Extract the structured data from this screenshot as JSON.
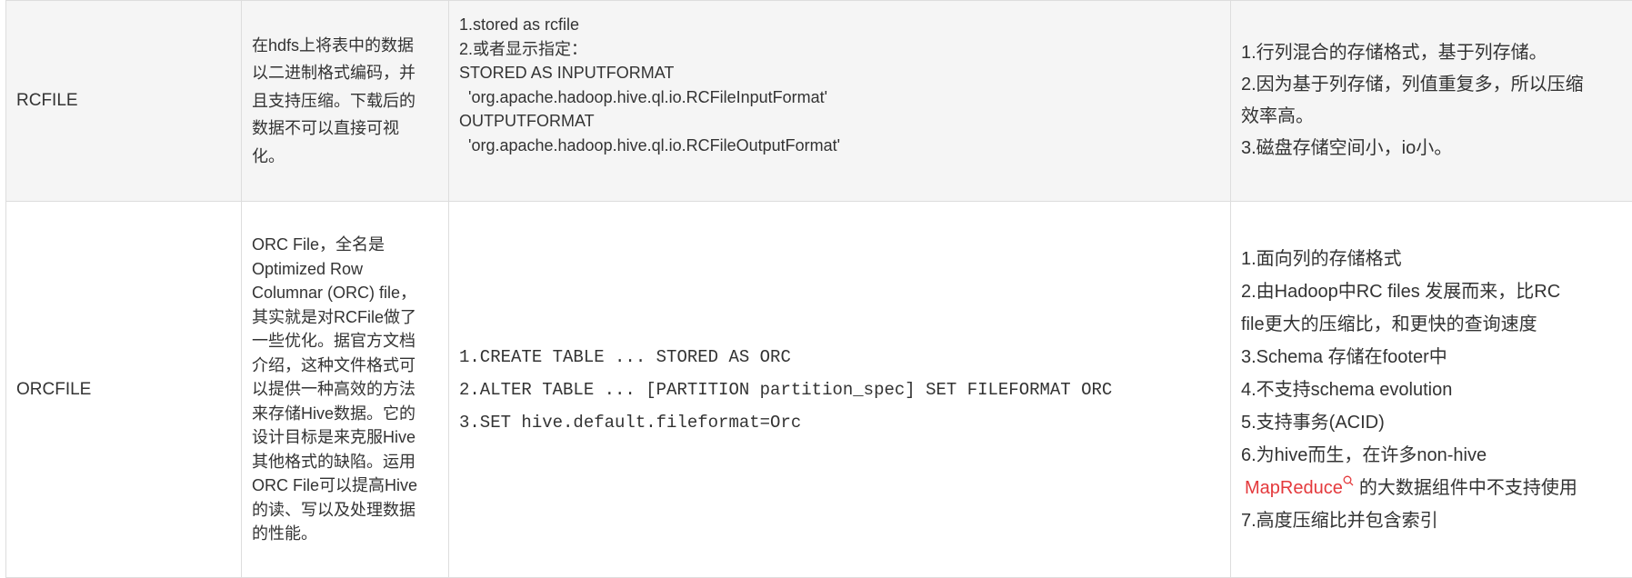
{
  "rows": [
    {
      "name": "RCFILE",
      "desc": [
        "在hdfs上将表中的数据",
        "以二进制格式编码，并",
        "且支持压缩。下载后的",
        "数据不可以直接可视",
        "化。"
      ],
      "usage": [
        "1.stored as rcfile",
        "2.或者显示指定：",
        "STORED AS INPUTFORMAT",
        "  'org.apache.hadoop.hive.ql.io.RCFileInputFormat'",
        "OUTPUTFORMAT",
        "  'org.apache.hadoop.hive.ql.io.RCFileOutputFormat'"
      ],
      "features": [
        "1.行列混合的存储格式，基于列存储。",
        "2.因为基于列存储，列值重复多，所以压缩",
        "效率高。",
        "3.磁盘存储空间小，io小。"
      ]
    },
    {
      "name": "ORCFILE",
      "desc": [
        "ORC File，全名是",
        "Optimized Row",
        "Columnar (ORC) file，",
        "其实就是对RCFile做了",
        "一些优化。据官方文档",
        "介绍，这种文件格式可",
        "以提供一种高效的方法",
        "来存储Hive数据。它的",
        "设计目标是来克服Hive",
        "其他格式的缺陷。运用",
        "ORC File可以提高Hive",
        "的读、写以及处理数据",
        "的性能。"
      ],
      "usage": [
        "1.CREATE TABLE ... STORED AS ORC",
        "2.ALTER TABLE ... [PARTITION partition_spec] SET FILEFORMAT ORC",
        "3.SET hive.default.fileformat=Orc"
      ],
      "features": [
        "1.面向列的存储格式",
        "2.由Hadoop中RC files 发展而来，比RC",
        "file更大的压缩比，和更快的查询速度",
        "3.Schema 存储在footer中",
        "4.不支持schema evolution",
        "5.支持事务(ACID)",
        "6.为hive而生，在许多non-hive"
      ],
      "link_text": "MapReduce",
      "link_tail": "的大数据组件中不支持使用",
      "features_last": "7.高度压缩比并包含索引"
    }
  ],
  "colors": {
    "link": "#e4393c",
    "row_alt_bg": "#f5f5f5",
    "border": "#dddddd"
  },
  "icons": {
    "link_icon": "search-icon"
  }
}
